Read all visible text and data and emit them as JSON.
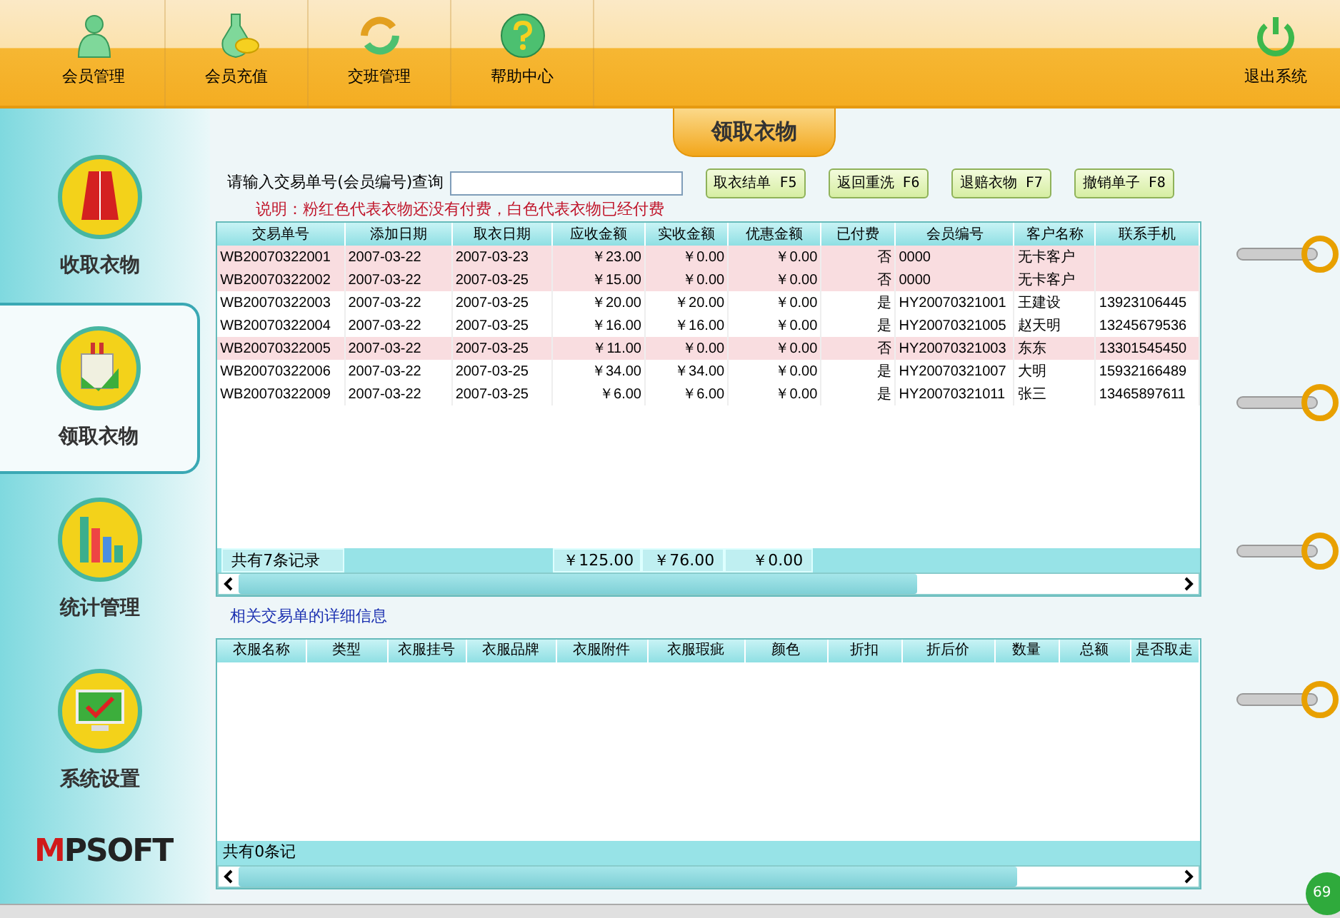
{
  "top_nav": [
    {
      "label": "会员管理"
    },
    {
      "label": "会员充值"
    },
    {
      "label": "交班管理"
    },
    {
      "label": "帮助中心"
    }
  ],
  "exit": {
    "label": "退出系统"
  },
  "sidebar": {
    "items": [
      {
        "label": "收取衣物",
        "selected": false
      },
      {
        "label": "领取衣物",
        "selected": true
      },
      {
        "label": "统计管理",
        "selected": false
      },
      {
        "label": "系统设置",
        "selected": false
      }
    ]
  },
  "logo": "MPSOFT",
  "page_title": "领取衣物",
  "search": {
    "label": "请输入交易单号(会员编号)查询"
  },
  "buttons": [
    "取衣结单 F5",
    "返回重洗 F6",
    "退赔衣物 F7",
    "撤销单子 F8"
  ],
  "note": "说明：粉红色代表衣物还没有付费，白色代表衣物已经付费",
  "orders": {
    "columns": [
      "交易单号",
      "添加日期",
      "取衣日期",
      "应收金额",
      "实收金额",
      "优惠金额",
      "已付费",
      "会员编号",
      "客户名称",
      "联系手机"
    ],
    "rows": [
      {
        "unpaid": true,
        "cells": [
          "WB20070322001",
          "2007-03-22",
          "2007-03-23",
          "￥23.00",
          "￥0.00",
          "￥0.00",
          "否",
          "0000",
          "无卡客户",
          ""
        ]
      },
      {
        "unpaid": true,
        "cells": [
          "WB20070322002",
          "2007-03-22",
          "2007-03-25",
          "￥15.00",
          "￥0.00",
          "￥0.00",
          "否",
          "0000",
          "无卡客户",
          ""
        ]
      },
      {
        "unpaid": false,
        "cells": [
          "WB20070322003",
          "2007-03-22",
          "2007-03-25",
          "￥20.00",
          "￥20.00",
          "￥0.00",
          "是",
          "HY20070321001",
          "王建设",
          "13923106445"
        ]
      },
      {
        "unpaid": false,
        "cells": [
          "WB20070322004",
          "2007-03-22",
          "2007-03-25",
          "￥16.00",
          "￥16.00",
          "￥0.00",
          "是",
          "HY20070321005",
          "赵天明",
          "13245679536"
        ]
      },
      {
        "unpaid": true,
        "cells": [
          "WB20070322005",
          "2007-03-22",
          "2007-03-25",
          "￥11.00",
          "￥0.00",
          "￥0.00",
          "否",
          "HY20070321003",
          "东东",
          "13301545450"
        ]
      },
      {
        "unpaid": false,
        "cells": [
          "WB20070322006",
          "2007-03-22",
          "2007-03-25",
          "￥34.00",
          "￥34.00",
          "￥0.00",
          "是",
          "HY20070321007",
          "大明",
          "15932166489"
        ]
      },
      {
        "unpaid": false,
        "cells": [
          "WB20070322009",
          "2007-03-22",
          "2007-03-25",
          "￥6.00",
          "￥6.00",
          "￥0.00",
          "是",
          "HY20070321011",
          "张三",
          "13465897611"
        ]
      }
    ],
    "summary": {
      "count": "共有7条记录",
      "totals": [
        "￥125.00",
        "￥76.00",
        "￥0.00"
      ]
    }
  },
  "detail": {
    "title": "相关交易单的详细信息",
    "columns": [
      "衣服名称",
      "类型",
      "衣服挂号",
      "衣服品牌",
      "衣服附件",
      "衣服瑕疵",
      "颜色",
      "折扣",
      "折后价",
      "数量",
      "总额",
      "是否取走"
    ],
    "summary": {
      "count": "共有0条记"
    }
  },
  "badge": "69"
}
